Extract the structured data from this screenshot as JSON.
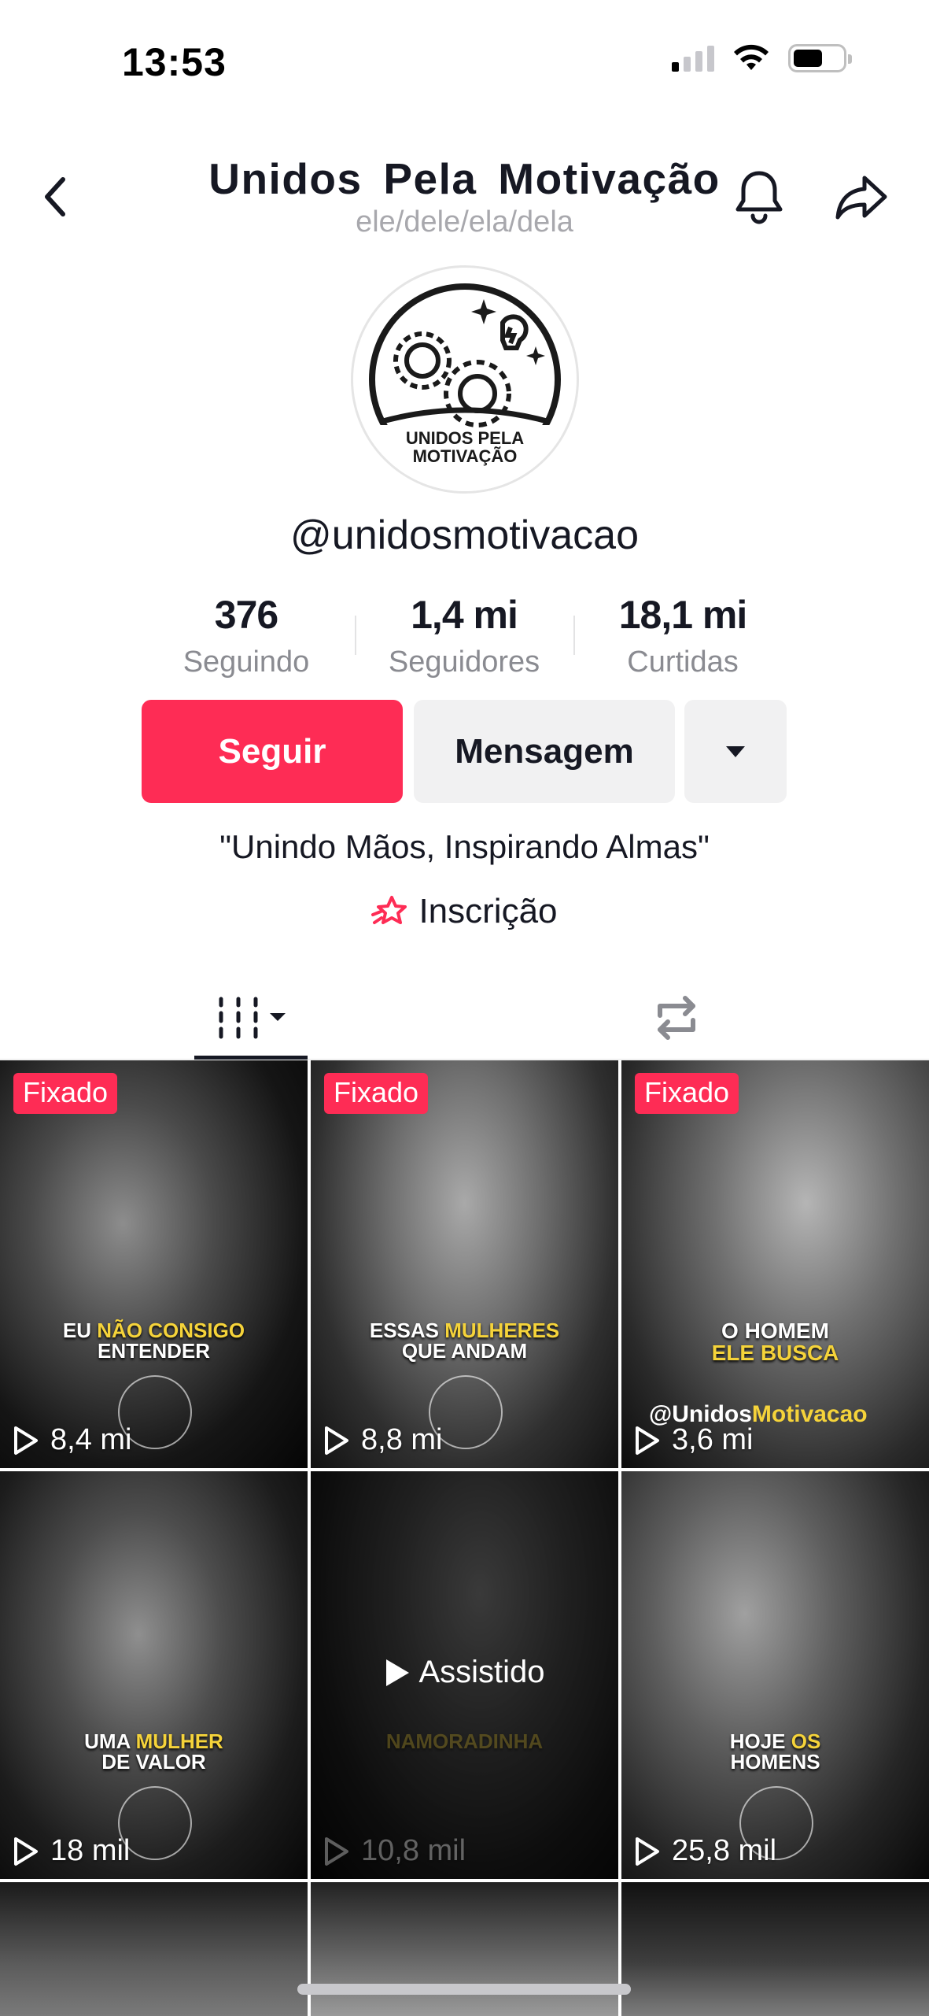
{
  "status_bar": {
    "time": "13:53"
  },
  "header": {
    "title": "Unidos Pela Motivação",
    "pronouns": "ele/dele/ela/dela"
  },
  "profile": {
    "avatar_text": "UNIDOS PELA MOTIVAÇÃO",
    "username": "@unidosmotivacao",
    "stats": [
      {
        "value": "376",
        "label": "Seguindo"
      },
      {
        "value": "1,4 mi",
        "label": "Seguidores"
      },
      {
        "value": "18,1 mi",
        "label": "Curtidas"
      }
    ],
    "bio": "\"Unindo Mãos, Inspirando Almas\"",
    "signup_label": "Inscrição"
  },
  "actions": {
    "follow_label": "Seguir",
    "message_label": "Mensagem"
  },
  "tabs": {
    "videos_icon": "grid-columns-icon",
    "reposts_icon": "repost-icon"
  },
  "videos": [
    {
      "pinned": "Fixado",
      "caption_a": "EU ",
      "caption_hl": "NÃO CONSIGO",
      "caption_b": "ENTENDER",
      "views": "8,4 mi"
    },
    {
      "pinned": "Fixado",
      "caption_a": "ESSAS ",
      "caption_hl": "MULHERES",
      "caption_b": "QUE ANDAM",
      "views": "8,8 mi"
    },
    {
      "pinned": "Fixado",
      "caption_a": "O HOMEM",
      "caption_hl": "ELE BUSCA",
      "caption_b": "",
      "handle_a": "@Unidos",
      "handle_hl": "Motivacao",
      "views": "3,6 mi"
    },
    {
      "caption_a": "UMA ",
      "caption_hl": "MULHER",
      "caption_b": "DE VALOR",
      "views": "18 mil"
    },
    {
      "caption_a": "",
      "caption_hl": "NAMORADINHA",
      "caption_b": "",
      "views": "10,8 mil",
      "watched": "Assistido"
    },
    {
      "caption_a": "HOJE ",
      "caption_hl": "OS",
      "caption_b": "HOMENS",
      "views": "25,8 mil"
    }
  ],
  "colors": {
    "accent": "#fe2c55",
    "caption_highlight": "#f5d33a",
    "secondary_button": "#f1f1f2"
  }
}
